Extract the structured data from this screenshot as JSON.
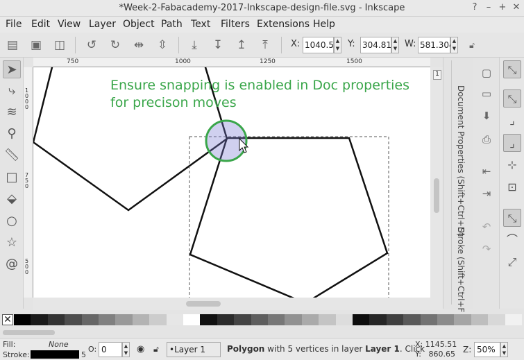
{
  "window": {
    "title": "*Week-2-Fabacademy-2017-Inkscape-design-file.svg - Inkscape",
    "controls": [
      "?",
      "–",
      "+",
      "✕"
    ]
  },
  "menu": [
    "File",
    "Edit",
    "View",
    "Layer",
    "Object",
    "Path",
    "Text",
    "Filters",
    "Extensions",
    "Help"
  ],
  "commands": [
    "document-icon",
    "select-all-icon",
    "select-all-layers-icon",
    "rotate-ccw-icon",
    "rotate-cw-icon",
    "flip-horizontal-icon",
    "flip-vertical-icon",
    "lower-to-bottom-icon",
    "lower-icon",
    "raise-icon",
    "raise-to-top-icon"
  ],
  "coords": {
    "x_label": "X:",
    "x_value": "1040.56",
    "y_label": "Y:",
    "y_value": "304.817",
    "w_label": "W:",
    "w_value": "581.304"
  },
  "tools": [
    "selector-icon",
    "node-icon",
    "tweak-icon",
    "zoom-icon",
    "measure-icon",
    "rectangle-icon",
    "3d-box-icon",
    "ellipse-icon",
    "star-icon",
    "spiral-icon"
  ],
  "ruler": {
    "h_ticks": [
      "750",
      "1000",
      "1250",
      "1500"
    ],
    "v_ticks": [
      "1000",
      "750",
      "500"
    ]
  },
  "canvas": {
    "hint_line1": "Ensure snapping is enabled in Doc properties",
    "hint_line2": "for precison moves"
  },
  "docks": {
    "doc_props": "Document Properties (Shift+Ctrl+D)",
    "stroke": "Stroke (Shift+Ctrl+F)",
    "xml_label": "1"
  },
  "snap_buttons": [
    "snap-enable-icon",
    "snap-bbox-icon",
    "snap-bbox-edge-icon",
    "snap-bbox-corner-icon",
    "snap-bbox-mid-icon",
    "snap-center-icon",
    "snap-nodes-icon",
    "snap-path-icon",
    "snap-cusp-icon"
  ],
  "palette_colors": [
    "#000000",
    "#1a1a1a",
    "#333333",
    "#4d4d4d",
    "#666666",
    "#808080",
    "#999999",
    "#b3b3b3",
    "#cccccc",
    "#e6e6e6",
    "#ffffff",
    "#111111",
    "#2b2b2b",
    "#444444",
    "#5e5e5e",
    "#777777",
    "#919191",
    "#aaaaaa",
    "#c4c4c4",
    "#dddddd",
    "#0d0d0d",
    "#262626",
    "#3f3f3f",
    "#595959",
    "#727272",
    "#8b8b8b",
    "#a5a5a5",
    "#bebebe",
    "#d8d8d8",
    "#f1f1f1"
  ],
  "status": {
    "fill_label": "Fill:",
    "fill_value": "None",
    "stroke_label": "Stroke:",
    "stroke_width": "5",
    "opacity_label": "O:",
    "opacity_value": "0",
    "layer": "•Layer 1",
    "message_bold": "Polygon",
    "message_mid": " with 5 vertices in layer ",
    "message_layer": "Layer 1",
    "message_end": ". Click",
    "x_coord": "X: 1145.51",
    "y_coord": "Y:   860.65",
    "zoom_label": "Z:",
    "zoom_value": "50%"
  }
}
